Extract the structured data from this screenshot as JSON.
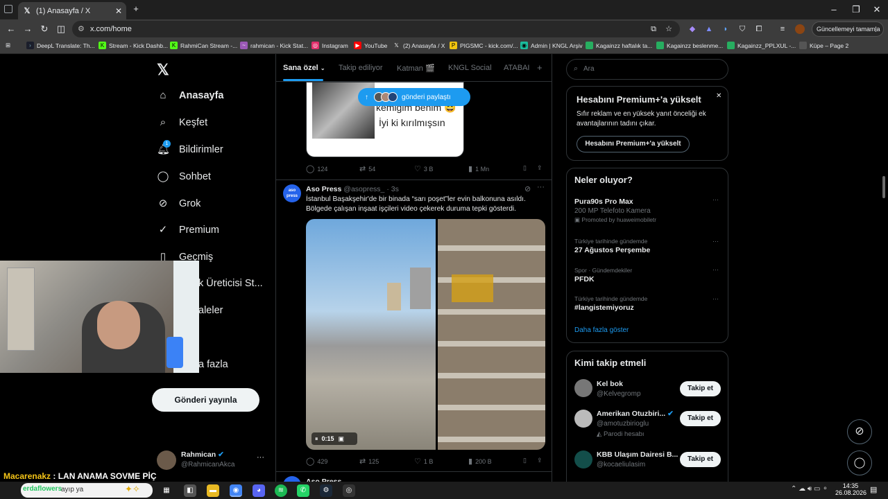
{
  "browser": {
    "tab_title": "(1) Anasayfa / X",
    "tab_close": "✕",
    "new_tab": "+",
    "url": "x.com/home",
    "update_button": "Güncellemeyi tamamla",
    "window_controls": [
      "–",
      "❐",
      "✕"
    ]
  },
  "bookmarks": [
    {
      "label": "DeepL Translate: Th...",
      "color": "#1b1e2b"
    },
    {
      "label": "Stream - Kick Dashb...",
      "color": "#53fc18"
    },
    {
      "label": "RahmiCan Stream -...",
      "color": "#53fc18"
    },
    {
      "label": "rahmican - Kick Stat...",
      "color": "#9b59b6"
    },
    {
      "label": "Instagram",
      "color": "#e1306c"
    },
    {
      "label": "YouTube",
      "color": "#ff0000"
    },
    {
      "label": "(2) Anasayfa / X",
      "color": "#000000"
    },
    {
      "label": "PIGSMC - kick.com/...",
      "color": "#f1c40f"
    },
    {
      "label": "Admin | KNGL Arşiv",
      "color": "#1abc9c"
    },
    {
      "label": "Kagainzz haftalık ta...",
      "color": "#27ae60"
    },
    {
      "label": "Kagainzz beslenme...",
      "color": "#27ae60"
    },
    {
      "label": "Kagainzz_PPLXUL -...",
      "color": "#27ae60"
    },
    {
      "label": "Küpe – Page 2",
      "color": "#555555"
    }
  ],
  "nav": {
    "items": [
      {
        "label": "Anasayfa",
        "icon": "home-icon"
      },
      {
        "label": "Keşfet",
        "icon": "search-icon"
      },
      {
        "label": "Bildirimler",
        "icon": "bell-icon",
        "badge": "1"
      },
      {
        "label": "Sohbet",
        "icon": "chat-icon"
      },
      {
        "label": "Grok",
        "icon": "grok-icon"
      },
      {
        "label": "Premium",
        "icon": "premium-icon"
      },
      {
        "label": "Geçmiş",
        "icon": "bookmark-icon"
      },
      {
        "label": "k Üreticisi St...",
        "icon": ""
      },
      {
        "label": "aleler",
        "icon": ""
      },
      {
        "label": "a fazla",
        "icon": ""
      }
    ],
    "post_button": "Gönderi yayınla",
    "account": {
      "name": "Rahmican",
      "handle": "@RahmicanAkca",
      "more": "···"
    }
  },
  "feed": {
    "tabs": [
      "Sana özel",
      "Takip ediliyor",
      "Katman 🎬",
      "KNGL Social",
      "ATABAI"
    ],
    "add_tab": "+",
    "new_posts_pill": "gönderi paylaştı",
    "prev_post": {
      "image_text_line1": "kemiğim benim 😄",
      "image_text_line2": "İyi ki kırılmışsın",
      "replies": "124",
      "reposts": "54",
      "likes": "3 B",
      "views": "1 Mn"
    },
    "post": {
      "author": "Aso Press",
      "handle": "@asopress_",
      "time": "· 3s",
      "avatar_text": "aso press",
      "text": "İstanbul Başakşehir'de bir binada “sarı poşet”ler evin balkonuna asıldı. Bölgede çalışan inşaat işçileri video çekerek duruma tepki gösterdi.",
      "video_time": "0:15",
      "replies": "429",
      "reposts": "125",
      "likes": "1 B",
      "views": "200 B"
    },
    "next_post_author": "Aso Press"
  },
  "sidebar": {
    "search_placeholder": "Ara",
    "premium": {
      "title": "Hesabını Premium+'a yükselt",
      "body": "Sıfır reklam ve en yüksek yanıt önceliği ek avantajlarının tadını çıkar.",
      "button": "Hesabını Premium+'a yükselt",
      "close": "✕"
    },
    "trends_title": "Neler oluyor?",
    "trends": [
      {
        "meta": "",
        "title": "Pura90s Pro Max",
        "sub": "200 MP Telefoto Kamera",
        "promo": "Promoted by huaweimobiletr"
      },
      {
        "meta": "Türkiye tarihinde gündemde",
        "title": "27 Ağustos Perşembe",
        "sub": "",
        "promo": ""
      },
      {
        "meta": "Spor · Gündemdekiler",
        "title": "PFDK",
        "sub": "",
        "promo": ""
      },
      {
        "meta": "Türkiye tarihinde gündemde",
        "title": "#langistemiyoruz",
        "sub": "",
        "promo": ""
      }
    ],
    "show_more": "Daha fazla göster",
    "who_to_follow_title": "Kimi takip etmeli",
    "who_to_follow": [
      {
        "name": "Kel bok",
        "handle": "@Kelvegromp",
        "extra": "",
        "button": "Takip et"
      },
      {
        "name": "Amerikan Otuzbiri...",
        "handle": "@amotuzbirioglu",
        "extra": "Parodi hesabı",
        "button": "Takip et"
      },
      {
        "name": "KBB Ulaşım Dairesi B...",
        "handle": "@kocaeliulasim",
        "extra": "",
        "button": "Takip et"
      }
    ]
  },
  "overlay": {
    "chat_user": "Macarenakz",
    "chat_message": " : LAN ANAMA SOVME PİÇ",
    "chat_user2": "erdaflowers",
    "chat_message2": " ayıp ya"
  },
  "taskbar": {
    "time": "14:35",
    "date": "26.08.2026"
  }
}
